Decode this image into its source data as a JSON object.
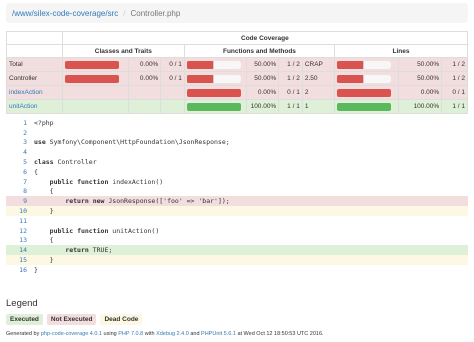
{
  "breadcrumb": {
    "root": "/www/silex-code-coverage/src",
    "separator": "/",
    "current": "Controller.php"
  },
  "coverage_table": {
    "title": "Code Coverage",
    "headers": [
      "Classes and Traits",
      "Functions and Methods",
      "Lines"
    ],
    "rows": [
      {
        "name": "Total",
        "link": false,
        "status": "danger",
        "classes_pct": "0.00%",
        "classes_ratio": "0 / 1",
        "classes_value": 0.0,
        "functions_pct": "50.00%",
        "functions_ratio": "1 / 2",
        "functions_value": 0.5,
        "crap": "CRAP",
        "lines_pct": "50.00%",
        "lines_ratio": "1 / 2",
        "lines_value": 0.5
      },
      {
        "name": "Controller",
        "link": false,
        "status": "danger",
        "classes_pct": "0.00%",
        "classes_ratio": "0 / 1",
        "classes_value": 0.0,
        "functions_pct": "50.00%",
        "functions_ratio": "1 / 2",
        "functions_value": 0.5,
        "crap": "2.50",
        "lines_pct": "50.00%",
        "lines_ratio": "1 / 2",
        "lines_value": 0.5
      },
      {
        "name": "indexAction",
        "link": true,
        "status": "danger",
        "classes_pct": "",
        "classes_ratio": "",
        "functions_pct": "0.00%",
        "functions_ratio": "0 / 1",
        "functions_value": 0.0,
        "crap": "2",
        "lines_pct": "0.00%",
        "lines_ratio": "0 / 1",
        "lines_value": 0.0
      },
      {
        "name": "unitAction",
        "link": true,
        "status": "success",
        "classes_pct": "",
        "classes_ratio": "",
        "functions_pct": "100.00%",
        "functions_ratio": "1 / 1",
        "functions_value": 1.0,
        "crap": "1",
        "lines_pct": "100.00%",
        "lines_ratio": "1 / 1",
        "lines_value": 1.0
      }
    ]
  },
  "code_lines": [
    {
      "n": "1",
      "text": "<?php",
      "status": ""
    },
    {
      "n": "2",
      "text": "",
      "status": ""
    },
    {
      "n": "3",
      "text": "use Symfony\\Component\\HttpFoundation\\JsonResponse;",
      "status": ""
    },
    {
      "n": "4",
      "text": "",
      "status": ""
    },
    {
      "n": "5",
      "text": "class Controller",
      "status": ""
    },
    {
      "n": "6",
      "text": "{",
      "status": ""
    },
    {
      "n": "7",
      "text": "    public function indexAction()",
      "status": ""
    },
    {
      "n": "8",
      "text": "    {",
      "status": ""
    },
    {
      "n": "9",
      "text": "        return new JsonResponse(['foo' => 'bar']);",
      "status": "danger"
    },
    {
      "n": "10",
      "text": "    }",
      "status": "warning"
    },
    {
      "n": "11",
      "text": "",
      "status": ""
    },
    {
      "n": "12",
      "text": "    public function unitAction()",
      "status": ""
    },
    {
      "n": "13",
      "text": "    {",
      "status": ""
    },
    {
      "n": "14",
      "text": "        return TRUE;",
      "status": "covered-by-large-tests"
    },
    {
      "n": "15",
      "text": "    }",
      "status": "warning"
    },
    {
      "n": "16",
      "text": "}",
      "status": ""
    }
  ],
  "legend": {
    "title": "Legend",
    "executed": "Executed",
    "not_executed": "Not Executed",
    "dead_code": "Dead Code"
  },
  "footer": {
    "prefix": "Generated by",
    "tool": "php-code-coverage 4.0.1",
    "using": "using",
    "php": "PHP 7.0.8",
    "with": "with",
    "xdebug": "Xdebug 2.4.0",
    "and": "and",
    "phpunit": "PHPUnit 5.6.1",
    "at": "at Wed Oct 12 18:50:53 UTC 2016."
  },
  "colors": {
    "danger": "#f2dede",
    "success": "#dff0d8",
    "warning": "#fcf8e3",
    "bar_red": "#d9534f",
    "bar_green": "#5cb85c",
    "link": "#337ab7"
  }
}
